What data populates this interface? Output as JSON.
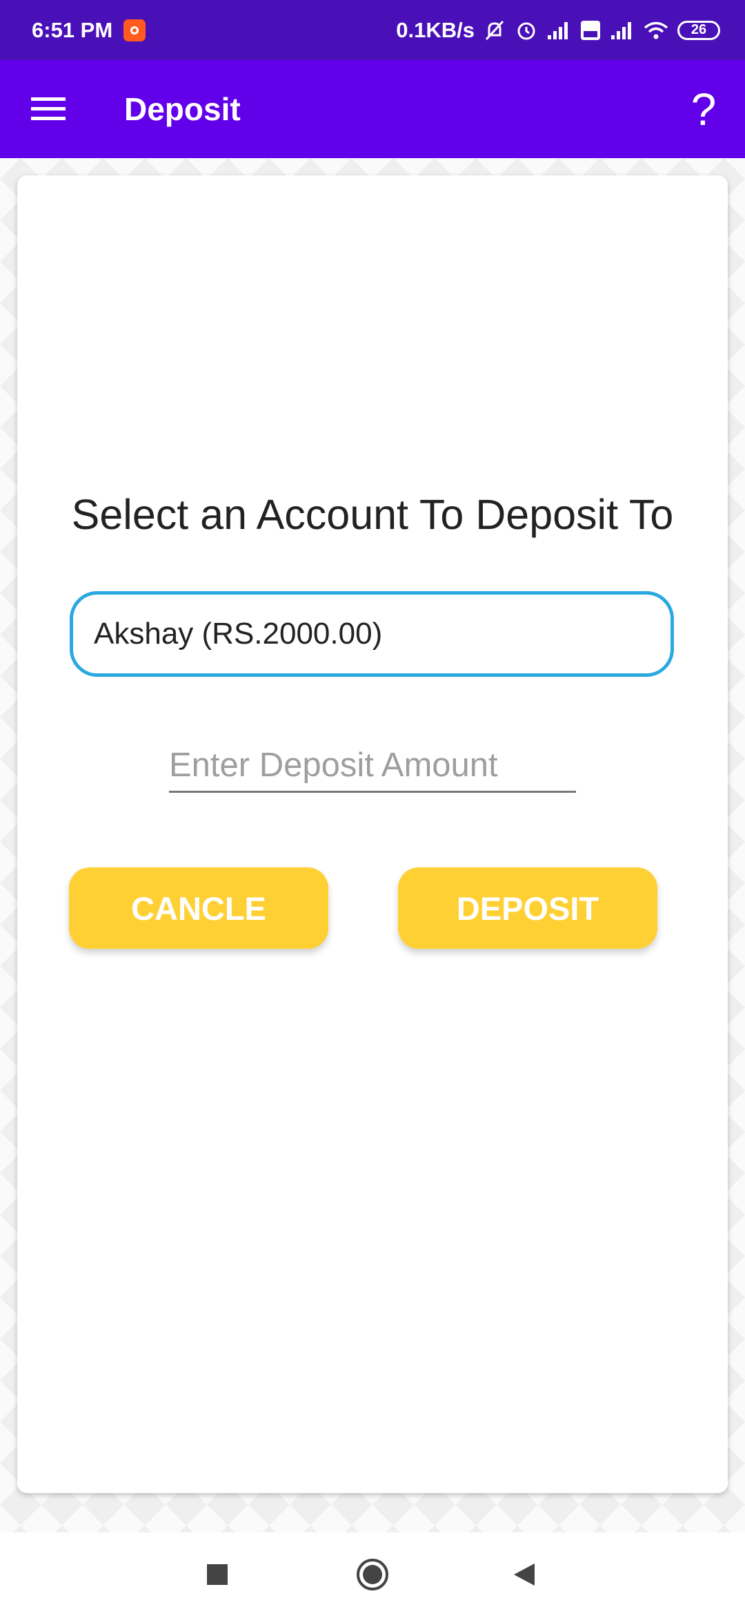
{
  "status_bar": {
    "time": "6:51 PM",
    "network_speed": "0.1KB/s",
    "battery": "26",
    "icons": [
      "mute-icon",
      "alarm-icon",
      "signal-icon",
      "volte-icon",
      "signal-icon",
      "wifi-icon",
      "battery-icon"
    ]
  },
  "app_bar": {
    "title": "Deposit",
    "help_label": "?"
  },
  "main": {
    "heading": "Select an Account To Deposit To",
    "account_selected": "Akshay (RS.2000.00)",
    "amount_placeholder": "Enter Deposit Amount",
    "amount_value": "",
    "cancel_label": "CANCLE",
    "deposit_label": "DEPOSIT"
  },
  "colors": {
    "status_bar": "#4a10b8",
    "app_bar": "#6200ea",
    "button": "#ffd033",
    "select_border": "#2aa8e0"
  }
}
